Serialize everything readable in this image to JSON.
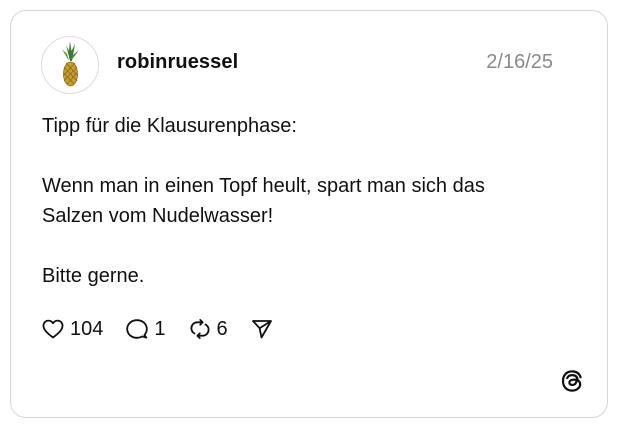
{
  "post": {
    "username": "robinruessel",
    "date": "2/16/25",
    "lines": {
      "line1": "Tipp für die Klausurenphase:",
      "line2": "Wenn man in einen Topf heult, spart man sich das",
      "line3": "Salzen vom Nudelwasser!",
      "line4": "Bitte gerne."
    }
  },
  "actions": {
    "likes": "104",
    "replies": "1",
    "reposts": "6"
  },
  "icons": {
    "avatar": "pineapple-avatar",
    "like": "heart-icon",
    "reply": "speech-bubble-icon",
    "repost": "repost-icon",
    "share": "send-icon",
    "brand": "threads-logo-icon"
  }
}
